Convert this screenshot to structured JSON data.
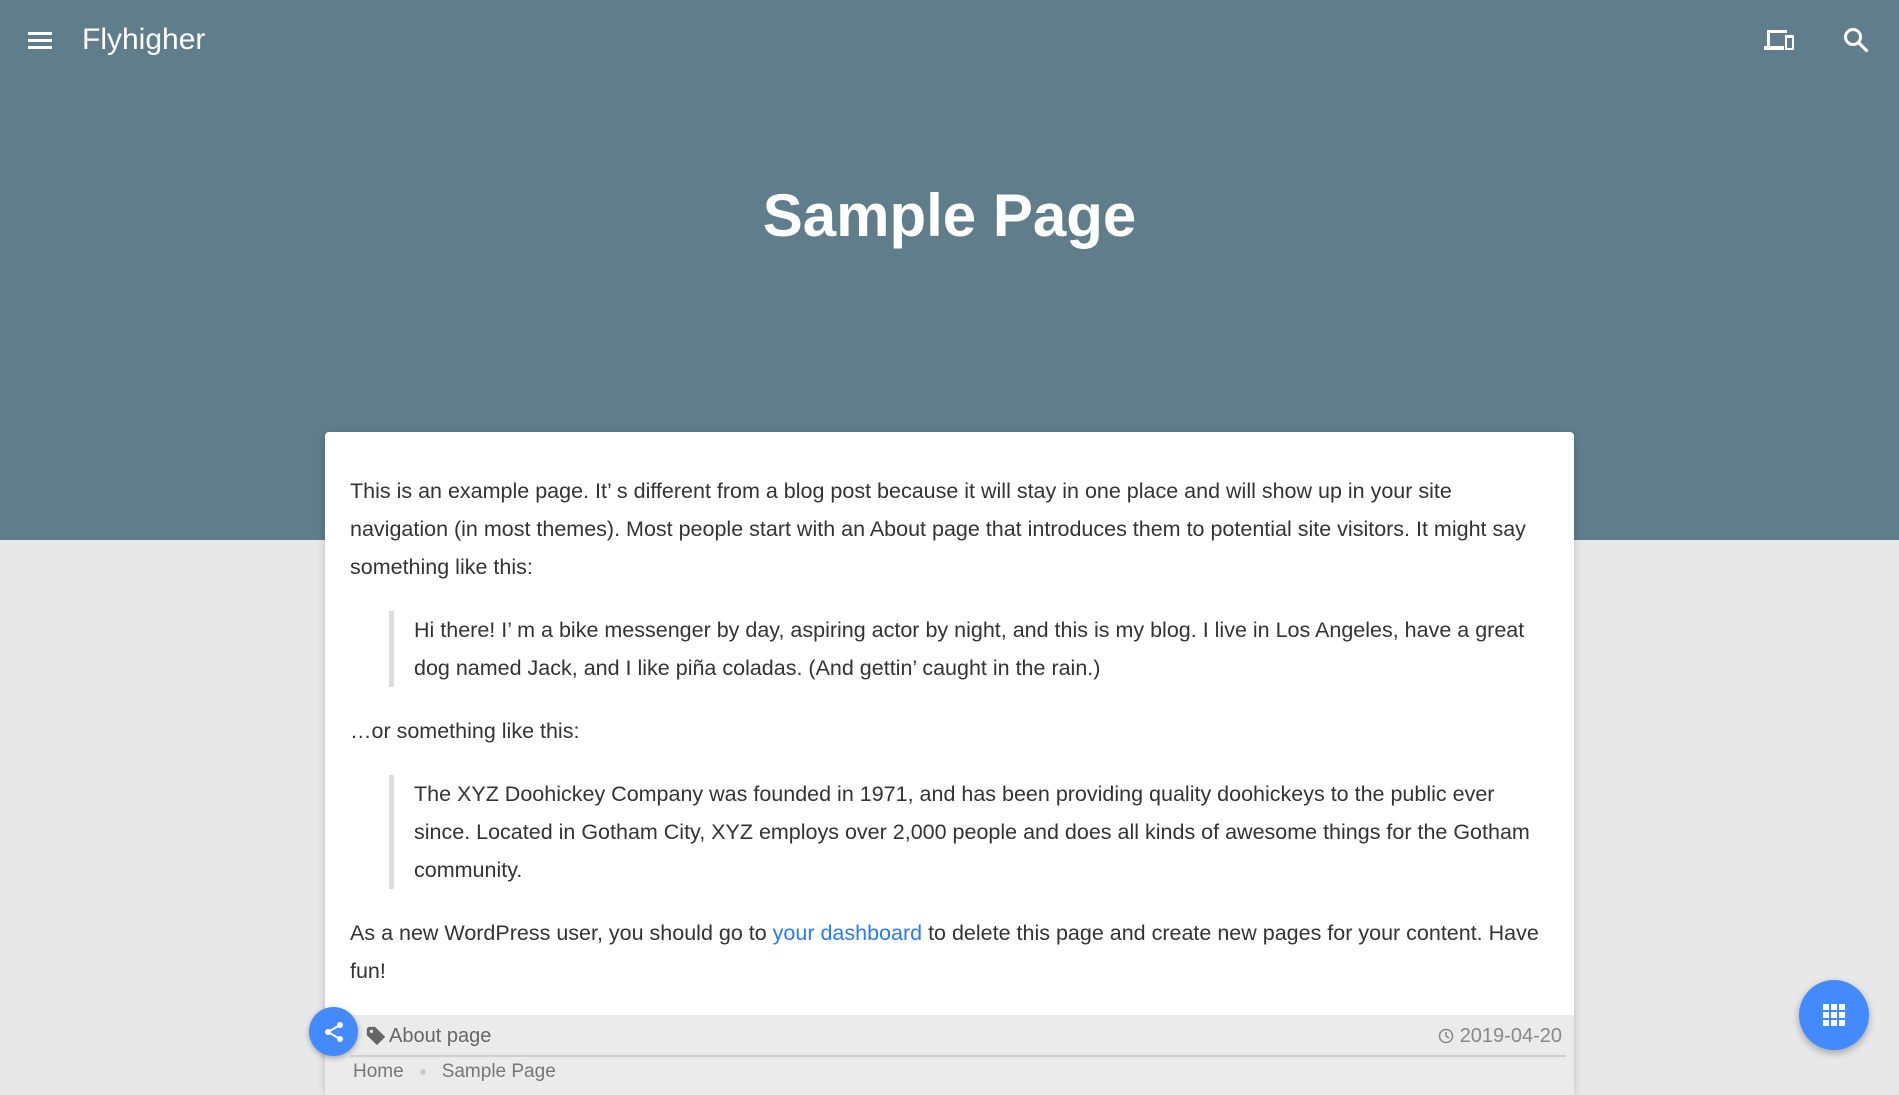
{
  "header": {
    "brand": "Flyhigher",
    "title": "Sample Page"
  },
  "content": {
    "p1": "This is an example page. It’ s different from a blog post because it will stay in one place and will show up in your site navigation (in most themes). Most people start with an About page that introduces them to potential site visitors. It might say something like this:",
    "quote1": "Hi there! I’ m a bike messenger by day, aspiring actor by night, and this is my blog. I live in Los Angeles, have a great dog named Jack, and I like piña coladas. (And gettin’  caught in the rain.)",
    "p2": "…or something like this:",
    "quote2": "The XYZ Doohickey Company was founded in 1971, and has been providing quality doohickeys to the public ever since. Located in Gotham City, XYZ employs over 2,000 people and does all kinds of awesome things for the Gotham community.",
    "p3_before": "As a new WordPress user, you should go to ",
    "p3_link": "your dashboard",
    "p3_after": " to delete this page and create new pages for your content. Have fun!"
  },
  "footer": {
    "tag": "About page",
    "date": "2019-04-20",
    "breadcrumb": [
      "Home",
      "Sample Page"
    ]
  },
  "colors": {
    "header": "#607d8b",
    "accent": "#448aff",
    "link": "#2979ff"
  }
}
